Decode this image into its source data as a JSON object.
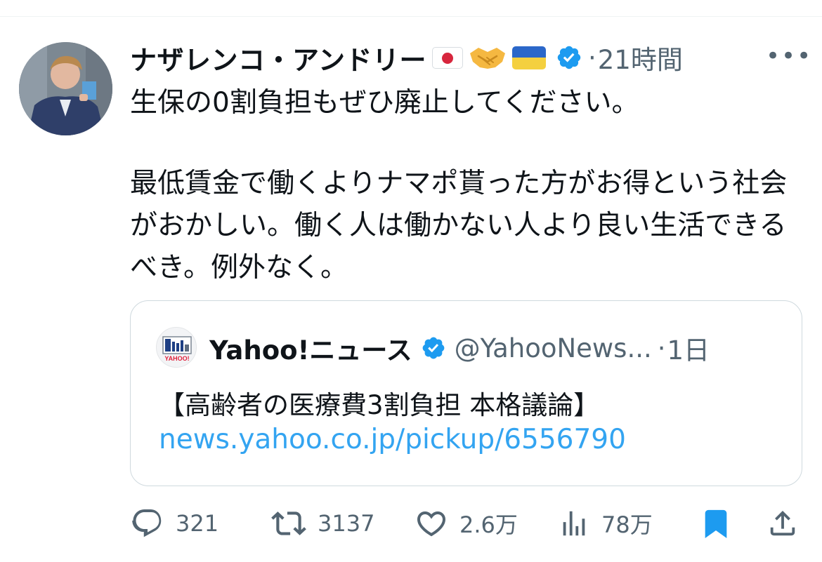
{
  "author": {
    "display_name": "ナザレンコ・アンドリー",
    "separator": "·",
    "time": "21時間"
  },
  "tweet": {
    "paragraphs": [
      "生保の0割負担もぜひ廃止してください。",
      "最低賃金で働くよりナマポ貰った方がお得という社会がおかしい。働く人は働かない人より良い生活できるべき。例外なく。"
    ]
  },
  "quoted_tweet": {
    "name": "Yahoo!ニュース",
    "handle": "@YahooNews...",
    "separator": "·",
    "time": "1日",
    "logo_text": "YAHOO!",
    "title": "【高齢者の医療費3割負担 本格議論】",
    "link": "news.yahoo.co.jp/pickup/6556790"
  },
  "actions": {
    "replies": "321",
    "retweets": "3137",
    "likes": "2.6万",
    "views": "78万"
  },
  "colors": {
    "text": "#0f1419",
    "secondary": "#536471",
    "link": "#1d9bf0",
    "verified": "#1d9bf0",
    "bookmark_active": "#1d9bf0"
  },
  "icons": [
    "more-icon",
    "verified-icon",
    "reply-icon",
    "retweet-icon",
    "like-icon",
    "views-icon",
    "bookmark-icon",
    "share-icon"
  ]
}
